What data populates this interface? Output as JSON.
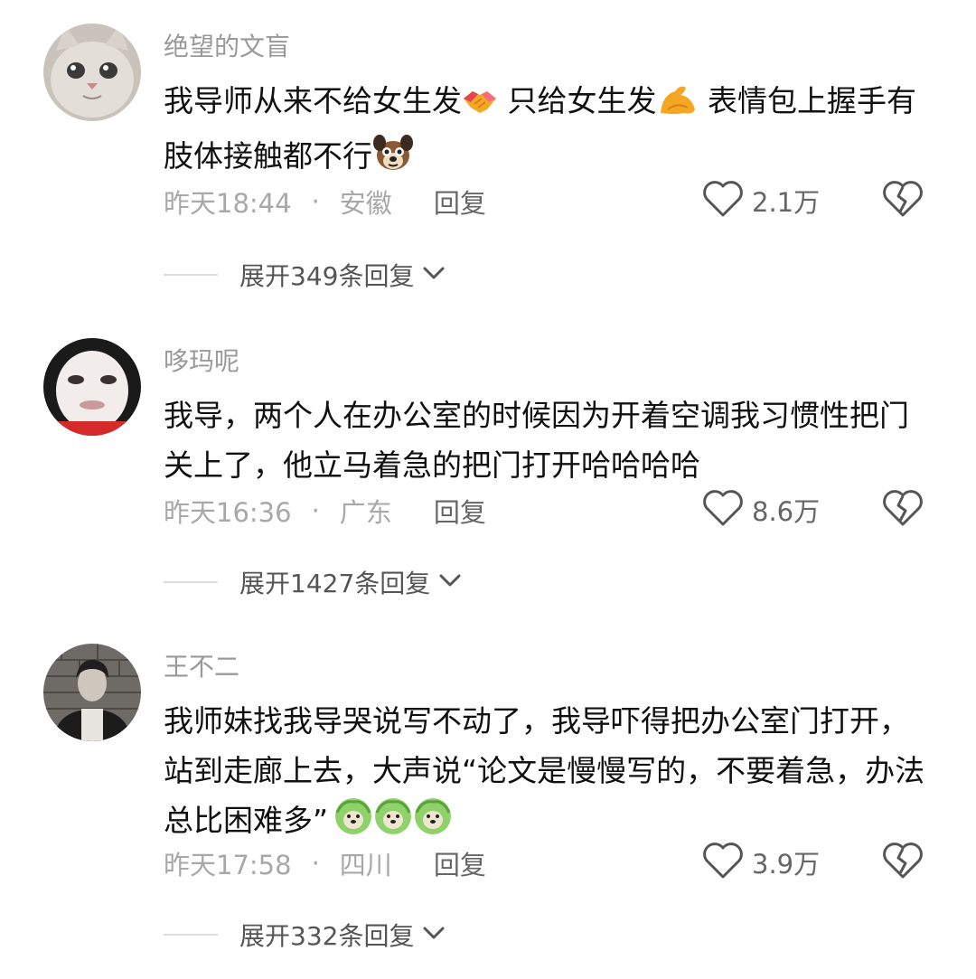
{
  "colors": {
    "username": "#999999",
    "meta": "#a8a8a8",
    "reply": "#666666",
    "text": "#111111"
  },
  "comments": [
    {
      "username": "绝望的文盲",
      "avatar_icon": "cat-avatar-icon",
      "text_parts": [
        "我导师从来不给女生发",
        " 只给女生发",
        " 表情包上握手有肢体接触都不行"
      ],
      "emojis": [
        "handshake-emoji-icon",
        "flexed-biceps-emoji-icon",
        "dog-emoji-icon"
      ],
      "time": "昨天18:44",
      "location": "安徽",
      "reply_label": "回复",
      "likes": "2.1万",
      "expand_label": "展开349条回复"
    },
    {
      "username": "哆玛呢",
      "avatar_icon": "pale-face-avatar-icon",
      "text_parts": [
        "我导，两个人在办公室的时候因为开着空调我习惯性把门关上了，他立马着急的把门打开哈哈哈哈"
      ],
      "emojis": [],
      "time": "昨天16:36",
      "location": "广东",
      "reply_label": "回复",
      "likes": "8.6万",
      "expand_label": "展开1427条回复"
    },
    {
      "username": "王不二",
      "avatar_icon": "man-photo-avatar-icon",
      "text_parts": [
        "我师妹找我导哭说写不动了，我导吓得把办公室门打开，站到走廊上去，大声说“论文是慢慢写的，不要着急，办法总比困难多”"
      ],
      "emojis": [
        "cabbage-dog-emoji-icon",
        "cabbage-dog-emoji-icon",
        "cabbage-dog-emoji-icon"
      ],
      "time": "昨天17:58",
      "location": "四川",
      "reply_label": "回复",
      "likes": "3.9万",
      "expand_label": "展开332条回复"
    }
  ]
}
